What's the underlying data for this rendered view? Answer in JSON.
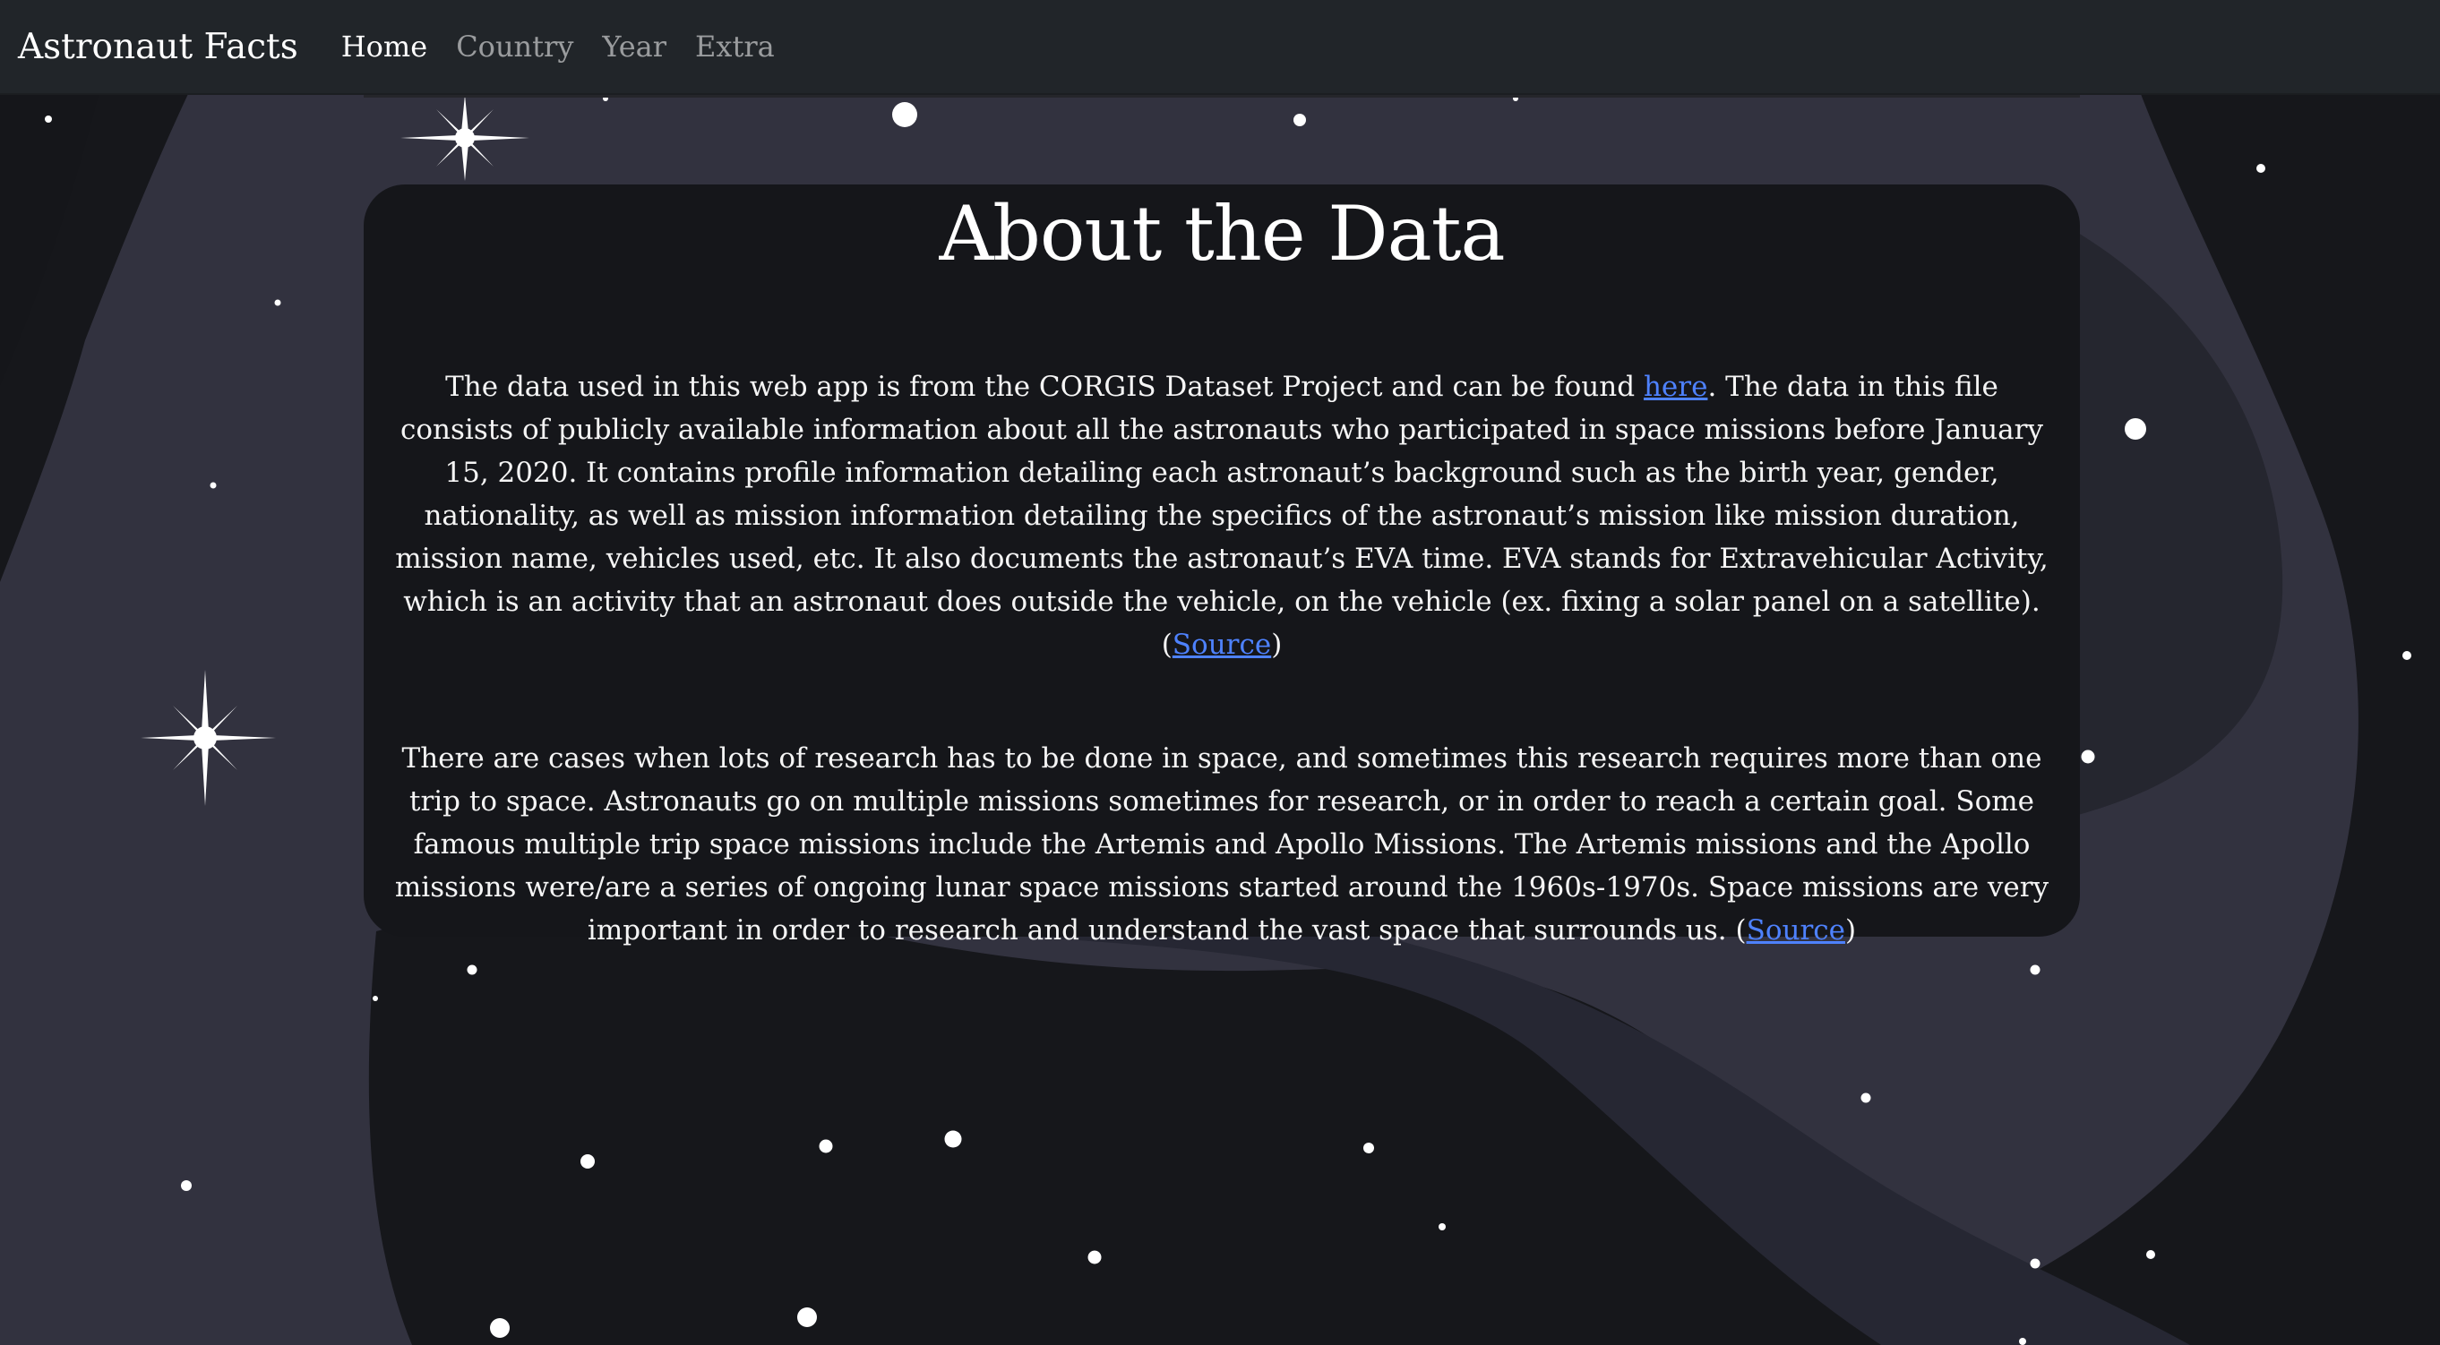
{
  "nav": {
    "brand": "Astronaut Facts",
    "items": [
      {
        "label": "Home",
        "active": true
      },
      {
        "label": "Country",
        "active": false
      },
      {
        "label": "Year",
        "active": false
      },
      {
        "label": "Extra",
        "active": false
      }
    ]
  },
  "main": {
    "title": "About the Data",
    "paragraph1": {
      "before_link": "The data used in this web app is from the CORGIS Dataset Project and can be found ",
      "link": "here",
      "after_link": ". The data in this file consists of publicly available information about all the astronauts who participated in space missions before January 15, 2020. It contains profile information detailing each astronaut’s background such as the birth year, gender, nationality, as well as mission information detailing the specifics of the astronaut’s mission like mission duration, mission name, vehicles used, etc. It also documents the astronaut’s EVA time. EVA stands for Extravehicular Activity, which is an activity that an astronaut does outside the vehicle, on the vehicle (ex. fixing a solar panel on a satellite). ",
      "source_open": "(",
      "source_link": "Source",
      "source_close": ")"
    },
    "paragraph2": {
      "text": "There are cases when lots of research has to be done in space, and sometimes this research requires more than one trip to space. Astronauts go on multiple missions sometimes for research, or in order to reach a certain goal. Some famous multiple trip space missions include the Artemis and Apollo Missions. The Artemis missions and the Apollo missions were/are a series of ongoing lunar space missions started around the 1960s-1970s. Space missions are very important in order to research and understand the vast space that surrounds us. ",
      "source_open": "(",
      "source_link": "Source",
      "source_close": ")"
    }
  },
  "colors": {
    "navbar_bg": "#212529",
    "page_bg": "#32323f",
    "dark_shape": "#15161a",
    "card_bg": "#15161a",
    "link": "#4e82ff",
    "star": "#ffffff"
  }
}
